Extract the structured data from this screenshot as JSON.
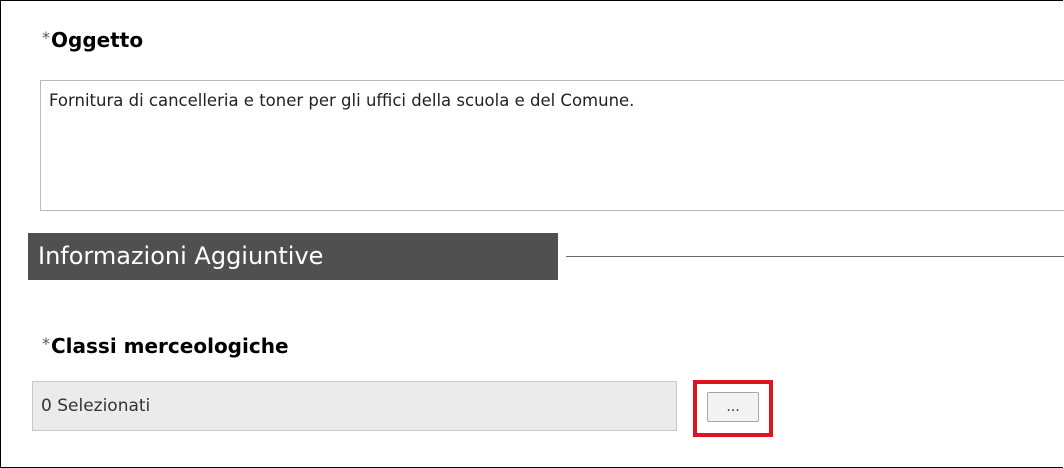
{
  "oggetto": {
    "required_mark": "*",
    "label": "Oggetto",
    "value": "Fornitura di cancelleria e toner per gli uffici della scuola e del Comune."
  },
  "section": {
    "title": "Informazioni Aggiuntive"
  },
  "classi": {
    "required_mark": "*",
    "label": "Classi merceologiche",
    "value": "0 Selezionati",
    "button_label": "..."
  },
  "colors": {
    "section_header_bg": "#505050",
    "highlight_border": "#e0141e",
    "readonly_field_bg": "#ebebeb"
  }
}
